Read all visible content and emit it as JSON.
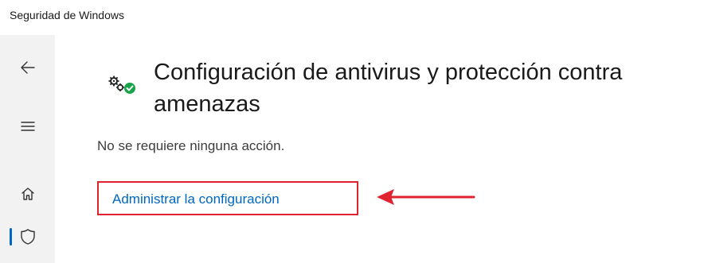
{
  "window": {
    "title": "Seguridad de Windows"
  },
  "sidebar": {
    "items": [
      {
        "name": "back",
        "icon": "back-arrow-icon"
      },
      {
        "name": "menu",
        "icon": "hamburger-menu-icon"
      },
      {
        "name": "home",
        "icon": "home-icon"
      },
      {
        "name": "virus-protection",
        "icon": "shield-icon",
        "active": true
      }
    ]
  },
  "main": {
    "section_icon": "gears-check-icon",
    "heading": "Configuración de antivirus y protección contra amenazas",
    "status_text": "No se requiere ninguna acción.",
    "manage_link": "Administrar la configuración",
    "annotation": "red-arrow-icon"
  },
  "colors": {
    "accent": "#0067c0",
    "highlight": "#e0242f",
    "status_ok": "#16a34a"
  }
}
